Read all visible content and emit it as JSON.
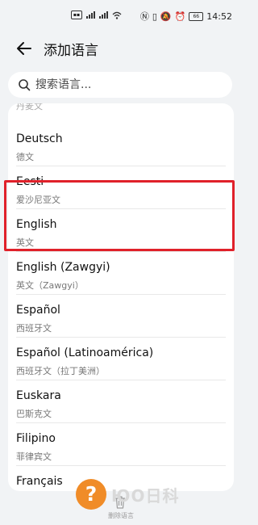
{
  "status_bar": {
    "battery": "66",
    "time": "14:52"
  },
  "header": {
    "title": "添加语言"
  },
  "search": {
    "placeholder": "搜索语言..."
  },
  "list": {
    "partial_top": "丹麦文",
    "items": [
      {
        "label": "Deutsch",
        "sub": "德文"
      },
      {
        "label": "Eesti",
        "sub": "爱沙尼亚文"
      },
      {
        "label": "English",
        "sub": "英文",
        "highlighted": true
      },
      {
        "label": "English (Zawgyi)",
        "sub": "英文（Zawgyi）"
      },
      {
        "label": "Español",
        "sub": "西班牙文"
      },
      {
        "label": "Español (Latinoamérica)",
        "sub": "西班牙文（拉丁美洲）"
      },
      {
        "label": "Euskara",
        "sub": "巴斯克文"
      },
      {
        "label": "Filipino",
        "sub": "菲律宾文"
      },
      {
        "label": "Français",
        "sub": ""
      }
    ]
  },
  "bottom_bar": {
    "delete_label": "删除语言"
  },
  "colors": {
    "highlight": "#e0212a",
    "background": "#f1f3f5"
  }
}
